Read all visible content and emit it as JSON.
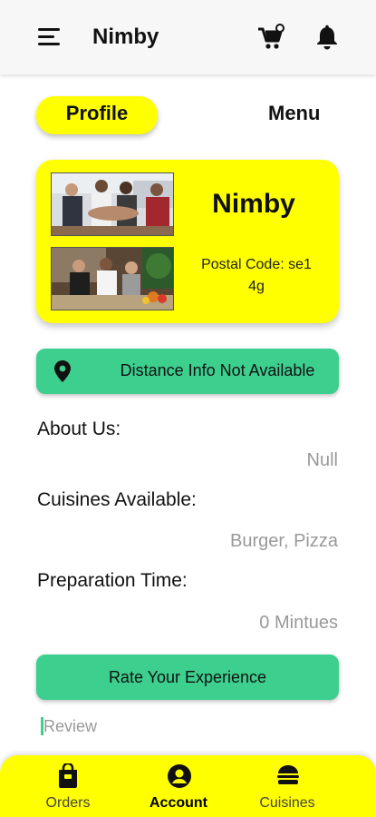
{
  "header": {
    "title": "Nimby",
    "menu_icon": "hamburger-menu-icon",
    "cart_icon": "shopping-cart-icon",
    "bell_icon": "notification-bell-icon"
  },
  "tabs": {
    "profile": "Profile",
    "menu": "Menu"
  },
  "profile_card": {
    "name": "Nimby",
    "postal_line1": "Postal Code: se1",
    "postal_line2": "4g",
    "photo1": "team-hands-photo",
    "photo2": "kitchen-staff-photo"
  },
  "distance": {
    "label": "Distance Info Not Available",
    "icon": "location-pin-icon"
  },
  "about": {
    "label": "About Us:",
    "value": "Null"
  },
  "cuisines": {
    "label": "Cuisines Available:",
    "value": "Burger, Pizza"
  },
  "prep_time": {
    "label": "Preparation Time:",
    "value": "0 Mintues"
  },
  "rate_button": "Rate Your Experience",
  "review": {
    "placeholder": "Review"
  },
  "bottom_nav": {
    "items": [
      {
        "label": "Orders",
        "icon": "orders-bag-icon",
        "active": false
      },
      {
        "label": "Account",
        "icon": "account-circle-icon",
        "active": true
      },
      {
        "label": "Cuisines",
        "icon": "burger-icon",
        "active": false
      }
    ]
  },
  "colors": {
    "accent_yellow": "#ffff00",
    "accent_green": "#3ccf8e"
  }
}
